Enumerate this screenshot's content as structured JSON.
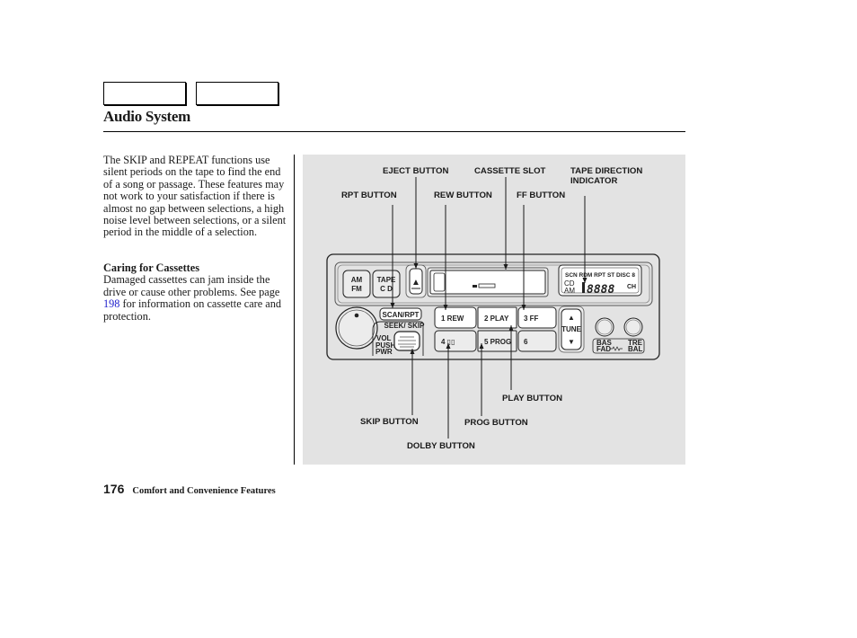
{
  "nav": {
    "tabs": [
      "",
      ""
    ]
  },
  "header": {
    "title": "Audio System"
  },
  "body": {
    "paragraph1": "The SKIP and REPEAT functions use silent periods on the tape to find the end of a song or passage. These features may not work to your satisfaction if there is almost no gap between selections, a high noise level between selections, or a silent period in the middle of a selection.",
    "caring_heading": "Caring for Cassettes",
    "caring_text_before": "Damaged cassettes can jam inside the drive or cause other problems. See page ",
    "caring_link": "198",
    "caring_text_after": " for information on cassette care and protection."
  },
  "footer": {
    "page_number": "176",
    "section": "Comfort and Convenience Features"
  },
  "figure": {
    "callouts": {
      "eject": "EJECT BUTTON",
      "cassette_slot": "CASSETTE SLOT",
      "tape_direction_1": "TAPE DIRECTION",
      "tape_direction_2": "INDICATOR",
      "rpt": "RPT BUTTON",
      "rew": "REW BUTTON",
      "ff": "FF BUTTON",
      "play": "PLAY BUTTON",
      "skip": "SKIP BUTTON",
      "prog": "PROG BUTTON",
      "dolby": "DOLBY BUTTON"
    },
    "radio": {
      "am_fm_1": "AM",
      "am_fm_2": "FM",
      "tape_cd_1": "TAPE",
      "tape_cd_2": "C D",
      "eject_glyph": "▲",
      "scan_rpt": "SCAN/RPT",
      "seek_skip": "SEEK/ SKIP",
      "vol": "VOL",
      "push": "PUSH",
      "pwr": "PWR",
      "preset1": "1  REW",
      "preset2": "2  PLAY",
      "preset3": "3    FF",
      "preset4": "4   ▯▯",
      "preset5": "5  PROG",
      "preset6": "6",
      "tune": "TUNE",
      "tune_up": "▲",
      "tune_down": "▼",
      "bas": "BAS",
      "fad": "FAD",
      "tre": "TRE",
      "bal": "BAL",
      "display_top": "SCN RDM RPT ST DISC 8",
      "display_cd": "CD",
      "display_am": "AM",
      "display_digits": "8888",
      "display_ch": "CH"
    }
  }
}
